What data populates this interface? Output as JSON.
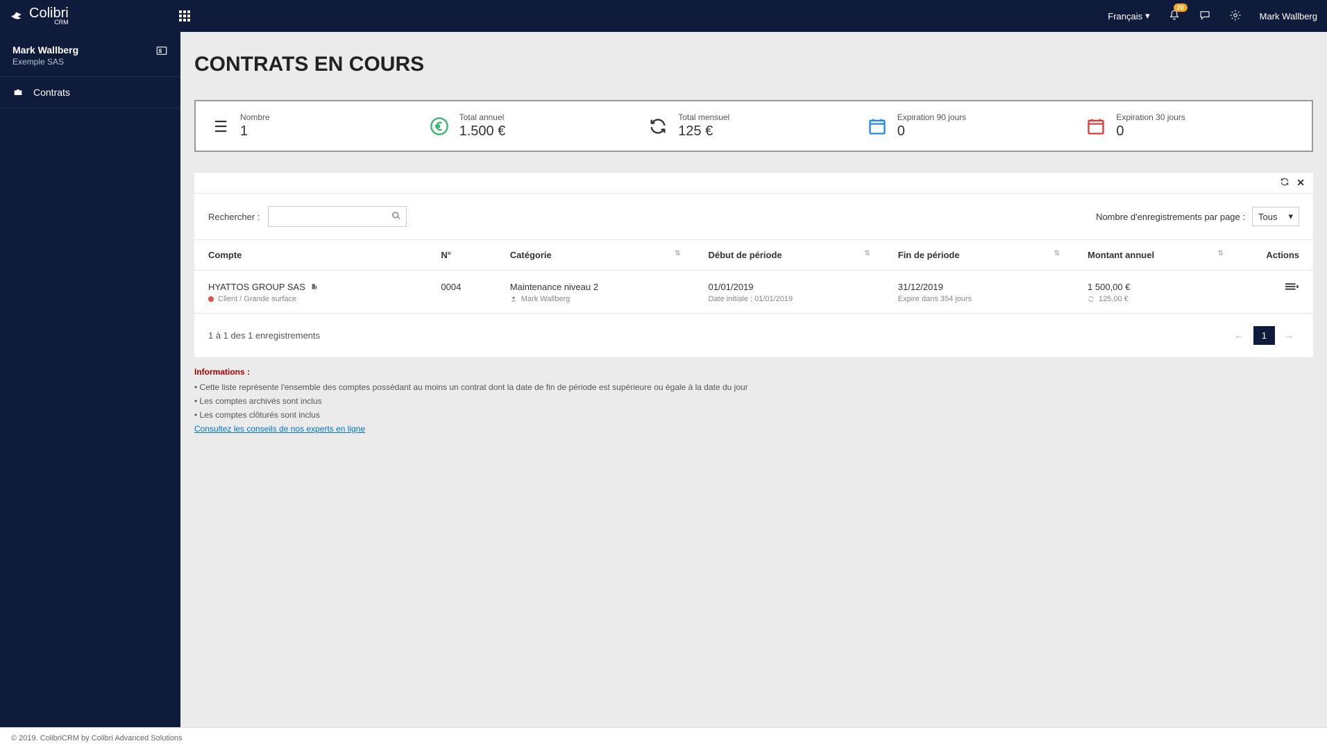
{
  "header": {
    "logo_name": "Colibri",
    "logo_sub": "CRM",
    "language": "Français",
    "notifications_count": "20",
    "user": "Mark Wallberg"
  },
  "sidebar": {
    "user_name": "Mark Wallberg",
    "company": "Exemple SAS",
    "nav": [
      {
        "label": "Contrats"
      }
    ]
  },
  "page": {
    "title": "CONTRATS EN COURS"
  },
  "stats": {
    "items": [
      {
        "label": "Nombre",
        "value": "1",
        "icon": "list"
      },
      {
        "label": "Total annuel",
        "value": "1.500 €",
        "icon": "euro"
      },
      {
        "label": "Total mensuel",
        "value": "125 €",
        "icon": "refresh"
      },
      {
        "label": "Expiration 90 jours",
        "value": "0",
        "icon": "cal-blue"
      },
      {
        "label": "Expiration 30 jours",
        "value": "0",
        "icon": "cal-red"
      }
    ]
  },
  "table_controls": {
    "search_label": "Rechercher :",
    "perpage_label": "Nombre d'enregistrements par page :",
    "perpage_value": "Tous"
  },
  "table": {
    "headers": {
      "account": "Compte",
      "number": "N°",
      "category": "Catégorie",
      "start": "Début de période",
      "end": "Fin de période",
      "amount": "Montant annuel",
      "actions": "Actions"
    },
    "rows": [
      {
        "account": "HYATTOS GROUP SAS",
        "account_sub": "Client / Grande surface",
        "number": "0004",
        "category": "Maintenance niveau 2",
        "category_sub": "Mark Wallberg",
        "start": "01/01/2019",
        "start_sub": "Date initiale : 01/01/2019",
        "end": "31/12/2019",
        "end_sub": "Expire dans 354 jours",
        "amount": "1 500,00 €",
        "amount_sub": "125,00 €"
      }
    ]
  },
  "pagination": {
    "info": "1 à 1 des 1 enregistrements",
    "current": "1",
    "prev": "←",
    "next": "→"
  },
  "info": {
    "title": "Informations :",
    "line1": "• Cette liste représente l'ensemble des comptes possédant au moins un contrat dont la date de fin de période est supérieure ou égale à la date du jour",
    "line2": "• Les comptes archivés sont inclus",
    "line3": "• Les comptes clôturés sont inclus",
    "link": "Consultez les conseils de nos experts en ligne"
  },
  "footer": {
    "text": "© 2019. ColibriCRM by Colibri Advanced Solutions"
  }
}
